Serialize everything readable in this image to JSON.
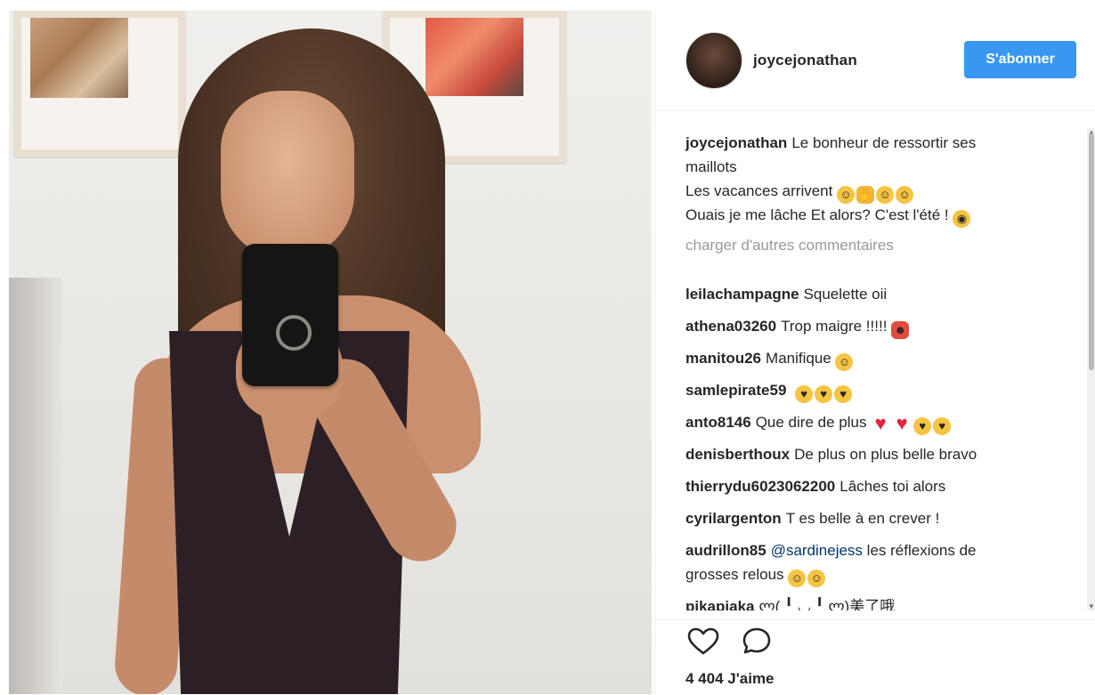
{
  "post": {
    "image_alt": "Selfie in mirror wearing a dark one-piece swimsuit"
  },
  "header": {
    "username": "joycejonathan",
    "follow_label": "S'abonner"
  },
  "caption": {
    "username": "joycejonathan",
    "line1": "Le bonheur de ressortir ses",
    "line2": "maillots",
    "line3": "Les vacances arrivent",
    "line4": "Ouais je me lâche Et alors? C'est l'été !"
  },
  "load_more": "charger d'autres commentaires",
  "comments": [
    {
      "user": "leilachampagne",
      "text": "Squelette oii"
    },
    {
      "user": "athena03260",
      "text": "Trop maigre !!!!!"
    },
    {
      "user": "manitou26",
      "text": "Manifique"
    },
    {
      "user": "samlepirate59",
      "text": ""
    },
    {
      "user": "anto8146",
      "text": "Que dire de plus"
    },
    {
      "user": "denisberthoux",
      "text": "De plus on plus belle bravo"
    },
    {
      "user": "thierrydu6023062200",
      "text": "Lâches toi alors"
    },
    {
      "user": "cyrilargenton",
      "text": "T es belle à en crever !"
    },
    {
      "user": "audrillon85",
      "mention": "@sardinejess",
      "text": "les réflexions de",
      "text2": "grosses relous"
    },
    {
      "user": "pikapiaka",
      "text": "ლ( ╹ ◡ ╹ ლ)美了哦"
    }
  ],
  "likes": "4 404 J'aime",
  "icons": {
    "like": "heart-outline-icon",
    "comment": "comment-bubble-icon"
  },
  "colors": {
    "follow_button": "#3897f0",
    "load_more": "#999999",
    "mention": "#003569"
  }
}
